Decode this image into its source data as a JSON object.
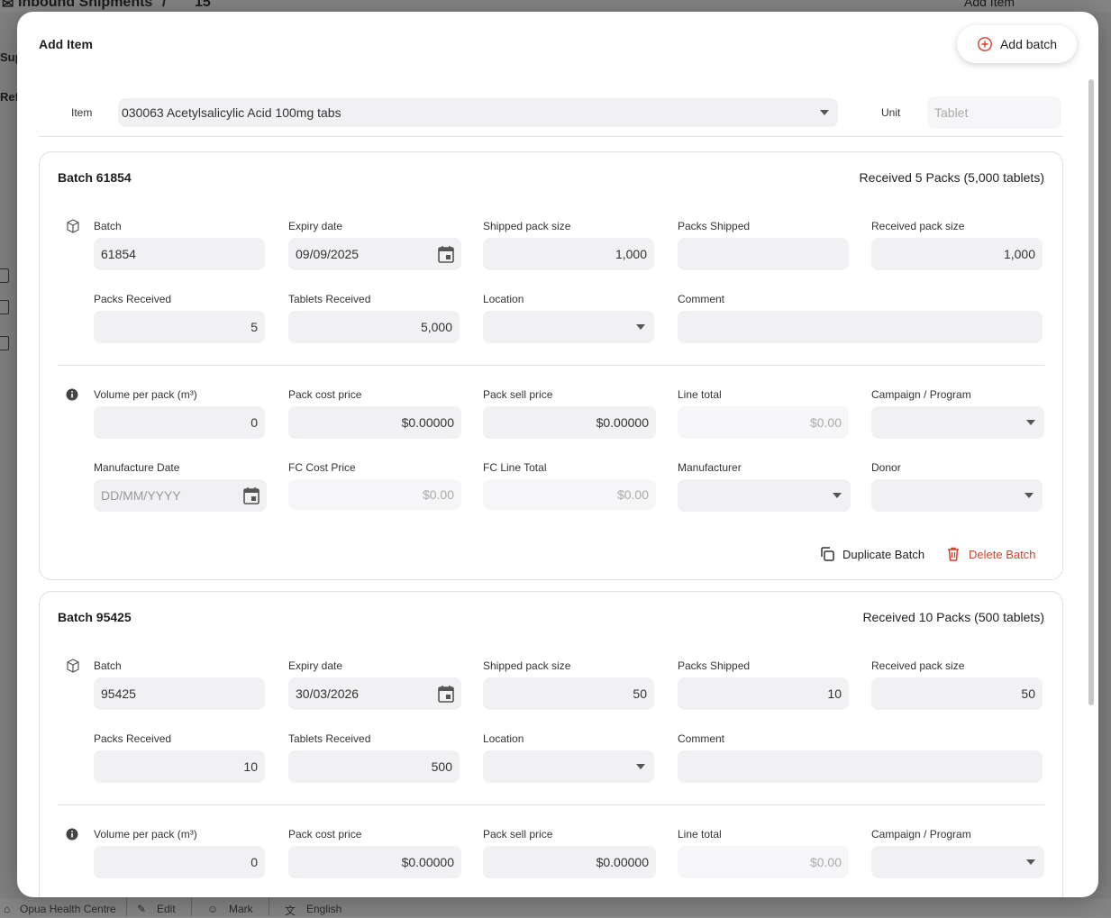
{
  "background": {
    "breadcrumb": "Inbound Shipments",
    "breadcrumb_sep": "/",
    "breadcrumb_number": "15",
    "add_item": "Add Item",
    "side_labels": [
      "Sup",
      "Ref"
    ],
    "footer": {
      "store": "Opua Health Centre",
      "edit": "Edit",
      "mark": "Mark",
      "language": "English"
    }
  },
  "modal": {
    "title": "Add Item",
    "add_batch_label": "Add batch",
    "item": {
      "label": "Item",
      "value": "030063 Acetylsalicylic Acid 100mg tabs",
      "unit_label": "Unit",
      "unit_placeholder": "Tablet"
    },
    "labels": {
      "batch": "Batch",
      "expiry": "Expiry date",
      "shipped_pack_size": "Shipped pack size",
      "packs_shipped": "Packs Shipped",
      "received_pack_size": "Received pack size",
      "packs_received": "Packs Received",
      "tablets_received": "Tablets Received",
      "location": "Location",
      "comment": "Comment",
      "volume": "Volume per pack (m³)",
      "pack_cost": "Pack cost price",
      "pack_sell": "Pack sell price",
      "line_total": "Line total",
      "campaign": "Campaign / Program",
      "manufacture_date": "Manufacture Date",
      "fc_cost": "FC Cost Price",
      "fc_line_total": "FC Line Total",
      "manufacturer": "Manufacturer",
      "donor": "Donor"
    },
    "actions": {
      "duplicate": "Duplicate Batch",
      "delete": "Delete Batch"
    },
    "batches": [
      {
        "title": "Batch 61854",
        "summary": "Received 5 Packs (5,000 tablets)",
        "batch": "61854",
        "expiry": "09/09/2025",
        "shipped_pack_size": "1,000",
        "packs_shipped": "",
        "received_pack_size": "1,000",
        "packs_received": "5",
        "tablets_received": "5,000",
        "location": "",
        "comment": "",
        "volume": "0",
        "pack_cost": "$0.00000",
        "pack_sell": "$0.00000",
        "line_total": "$0.00",
        "campaign": "",
        "manufacture_date_placeholder": "DD/MM/YYYY",
        "fc_cost": "$0.00",
        "fc_line_total": "$0.00",
        "manufacturer": "",
        "donor": ""
      },
      {
        "title": "Batch 95425",
        "summary": "Received 10 Packs (500 tablets)",
        "batch": "95425",
        "expiry": "30/03/2026",
        "shipped_pack_size": "50",
        "packs_shipped": "10",
        "received_pack_size": "50",
        "packs_received": "10",
        "tablets_received": "500",
        "location": "",
        "comment": "",
        "volume": "0",
        "pack_cost": "$0.00000",
        "pack_sell": "$0.00000",
        "line_total": "$0.00",
        "campaign": ""
      }
    ]
  },
  "colors": {
    "accent_red": "#d8402a",
    "input_bg": "#f1f1f4"
  }
}
